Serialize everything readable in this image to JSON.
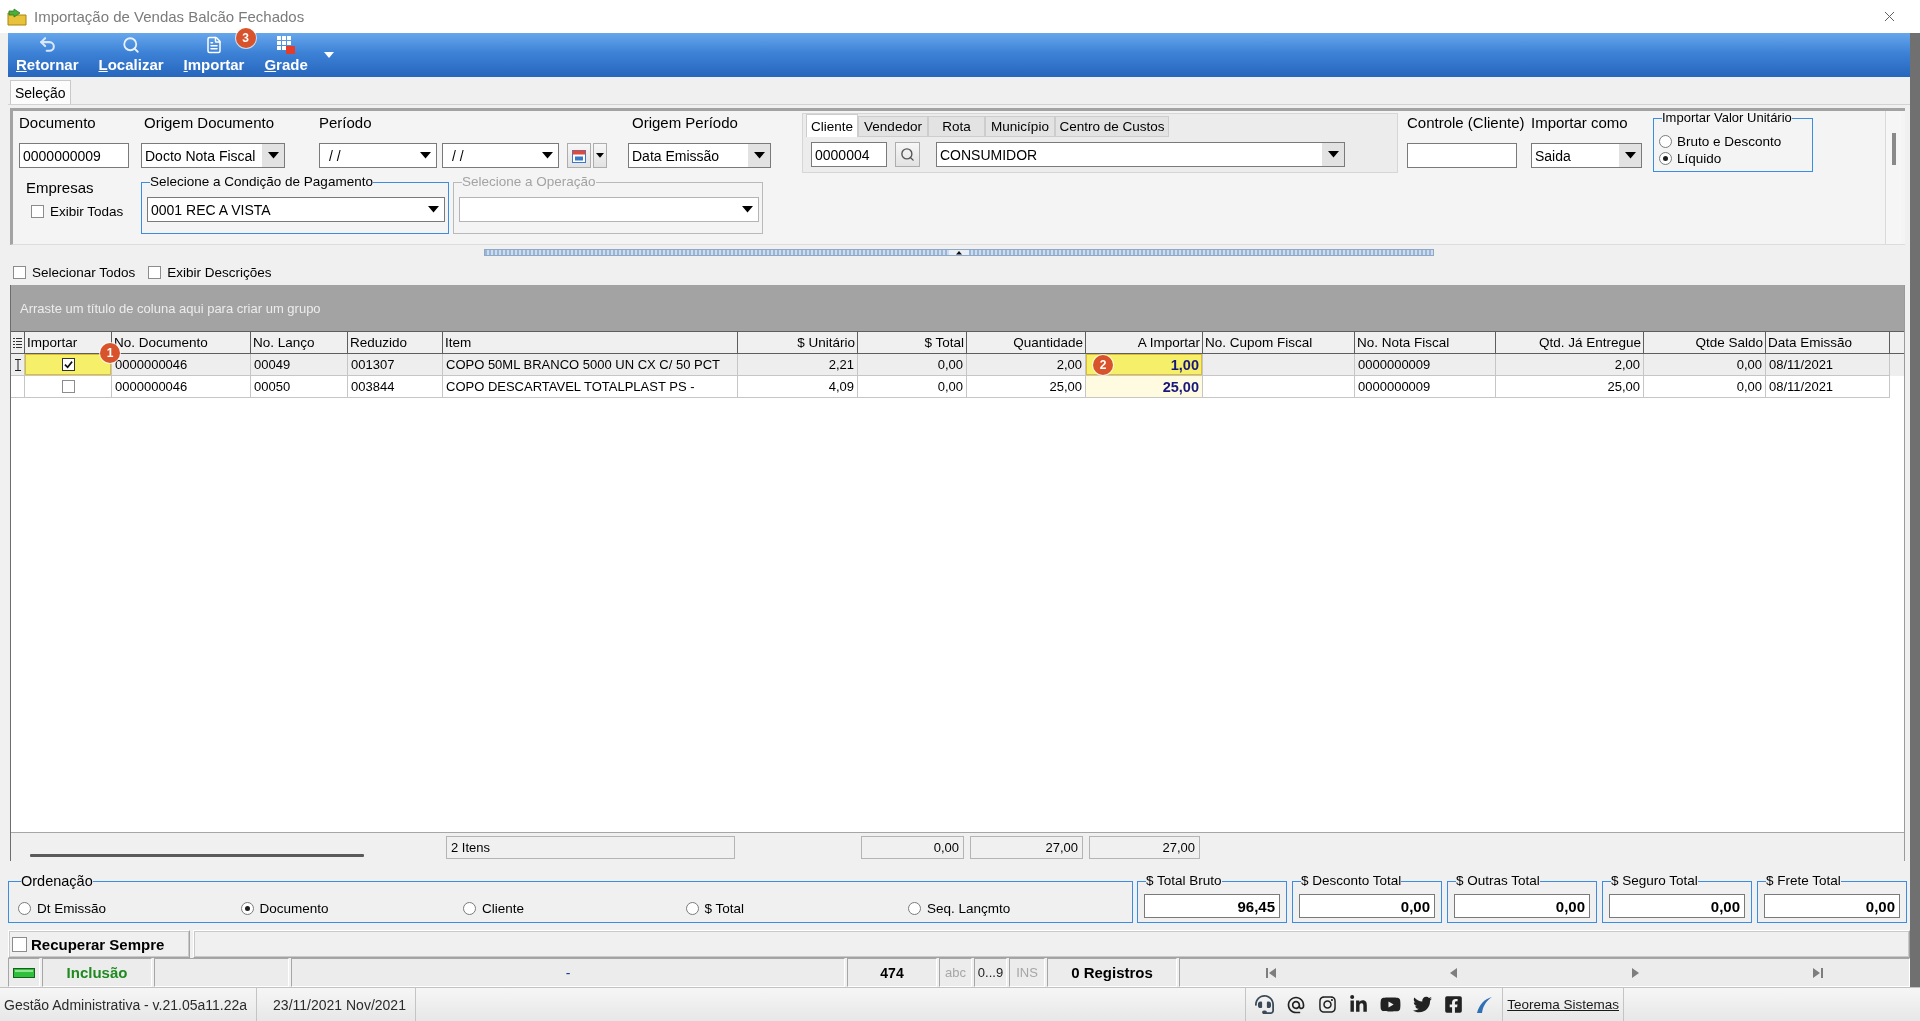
{
  "window": {
    "title": "Importação de Vendas Balcão Fechados"
  },
  "toolbar": {
    "buttons": [
      {
        "label": "Retornar",
        "kind": "undo"
      },
      {
        "label": "Localizar",
        "kind": "search"
      },
      {
        "label": "Importar",
        "kind": "document",
        "badge": "3"
      },
      {
        "label": "Grade",
        "kind": "grid",
        "menu": true
      }
    ]
  },
  "tabs": [
    {
      "label": "Seleção",
      "selected": true
    }
  ],
  "filters": {
    "documento": {
      "label": "Documento",
      "value": "0000000009"
    },
    "origem_documento": {
      "label": "Origem Documento",
      "value": "Docto Nota Fiscal"
    },
    "periodo": {
      "label": "Período",
      "from": "/ /",
      "to": "/ /"
    },
    "origem_periodo": {
      "label": "Origem Período",
      "value": "Data Emissão"
    },
    "party": {
      "tabs": [
        {
          "label": "Cliente",
          "selected": true
        },
        {
          "label": "Vendedor",
          "selected": false
        },
        {
          "label": "Rota",
          "selected": false
        },
        {
          "label": "Município",
          "selected": false
        },
        {
          "label": "Centro de Custos",
          "selected": false
        }
      ],
      "code": "0000004",
      "name": "CONSUMIDOR"
    },
    "controle": {
      "label": "Controle (Cliente)"
    },
    "importar_como": {
      "label": "Importar como",
      "value": "Saida"
    },
    "valor_unitario": {
      "title": "Importar Valor Unitário",
      "options": [
        {
          "label": "Bruto e Desconto",
          "selected": false
        },
        {
          "label": "Líquido",
          "selected": true
        }
      ]
    },
    "empresas": {
      "label": "Empresas",
      "option": {
        "label": "Exibir Todas",
        "checked": false
      }
    },
    "condicao_pagamento": {
      "title": "Selecione a Condição de Pagamento",
      "value": "0001 REC A VISTA",
      "disabled": false
    },
    "operacao": {
      "title": "Selecione a Operação",
      "disabled": true
    }
  },
  "grid_options": [
    {
      "label": "Selecionar Todos",
      "checked": false
    },
    {
      "label": "Exibir Descrições",
      "checked": false
    }
  ],
  "group_panel": {
    "hint": "Arraste um título de coluna aqui para criar um grupo"
  },
  "table": {
    "columns": [
      {
        "label": "Importar",
        "kind": "check"
      },
      {
        "label": "No. Documento",
        "kind": "text"
      },
      {
        "label": "No. Lanço",
        "kind": "text"
      },
      {
        "label": "Reduzido",
        "kind": "text"
      },
      {
        "label": "Item",
        "kind": "text"
      },
      {
        "label": "$ Unitário",
        "kind": "number"
      },
      {
        "label": "$ Total",
        "kind": "number"
      },
      {
        "label": "Quantidade",
        "kind": "number"
      },
      {
        "label": "A Importar",
        "kind": "entry"
      },
      {
        "label": "No. Cupom Fiscal",
        "kind": "text"
      },
      {
        "label": "No. Nota Fiscal",
        "kind": "text"
      },
      {
        "label": "Qtd. Já Entregue",
        "kind": "number"
      },
      {
        "label": "Qtde Saldo",
        "kind": "number"
      },
      {
        "label": "Data Emissão",
        "kind": "text"
      }
    ],
    "rows": [
      {
        "selected": true,
        "cells": [
          {
            "checked": true,
            "highlight": true,
            "badge": "1"
          },
          "0000000046",
          "00049",
          "001307",
          "COPO 50ML BRANCO 5000 UN CX C/ 50 PCT",
          "2,21",
          "0,00",
          "2,00",
          {
            "text": "1,00",
            "highlight": true,
            "badge": "2"
          },
          null,
          "0000000009",
          "2,00",
          "0,00",
          "08/11/2021"
        ]
      },
      {
        "selected": false,
        "cells": [
          {
            "checked": false,
            "highlight": false
          },
          "0000000046",
          "00050",
          "003844",
          "COPO DESCARTAVEL TOTALPLAST PS -",
          "4,09",
          "0,00",
          "25,00",
          {
            "text": "25,00",
            "highlight": false
          },
          null,
          "0000000009",
          "25,00",
          "0,00",
          "08/11/2021"
        ]
      }
    ],
    "footer": {
      "count": "2 Itens",
      "sums": [
        "0,00",
        "27,00",
        "27,00"
      ]
    }
  },
  "ordenacao": {
    "title": "Ordenação",
    "options": [
      {
        "label": "Dt Emissão",
        "selected": false
      },
      {
        "label": "Documento",
        "selected": true
      },
      {
        "label": "Cliente",
        "selected": false
      },
      {
        "label": "$ Total",
        "selected": false
      },
      {
        "label": "Seq. Lançmto",
        "selected": false
      }
    ]
  },
  "totals": [
    {
      "label": "$ Total Bruto",
      "value": "96,45"
    },
    {
      "label": "$ Desconto Total",
      "value": "0,00"
    },
    {
      "label": "$ Outras Total",
      "value": "0,00"
    },
    {
      "label": "$ Seguro Total",
      "value": "0,00"
    },
    {
      "label": "$ Frete Total",
      "value": "0,00"
    }
  ],
  "recuperar_sempre": {
    "label": "Recuperar Sempre",
    "checked": false
  },
  "status_bar": {
    "mode": "Inclusão",
    "message": "-",
    "code": "474",
    "flags": [
      {
        "label": "abc",
        "on": false
      },
      {
        "label": "0...9",
        "on": true
      },
      {
        "label": "INS",
        "on": false
      }
    ],
    "records": "0 Registros"
  },
  "taskbar": {
    "app": "Gestão Administrativa - v.21.05a11.22a",
    "date": "23/11/2021 Nov/2021",
    "link": "Teorema Sistemas"
  }
}
